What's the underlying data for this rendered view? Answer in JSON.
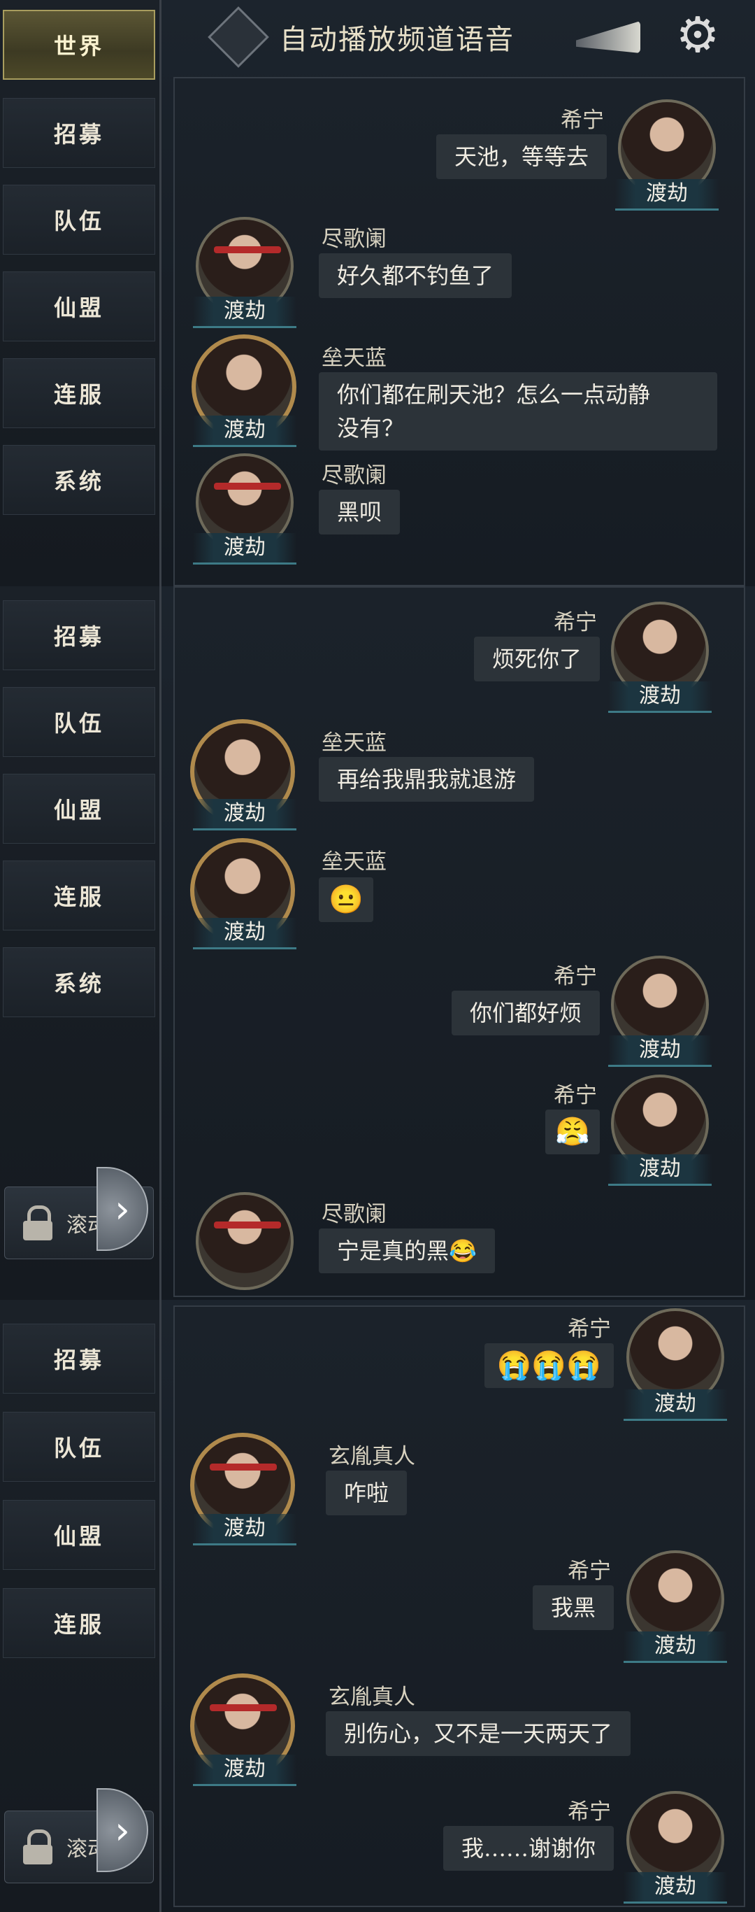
{
  "header": {
    "active_tab": "世界",
    "title": "自动播放频道语音"
  },
  "sidebar_sections": [
    [
      "招募",
      "队伍",
      "仙盟",
      "连服",
      "系统"
    ],
    [
      "招募",
      "队伍",
      "仙盟",
      "连服",
      "系统"
    ],
    [
      "招募",
      "队伍",
      "仙盟",
      "连服"
    ]
  ],
  "lock_label": "滚动",
  "arrow_glyph": "›",
  "rank_tag": "渡劫",
  "messages_1": [
    {
      "name": "希宁",
      "text": "天池，等等去"
    },
    {
      "name": "尽歌阑",
      "text": "好久都不钓鱼了"
    },
    {
      "name": "垒天蓝",
      "text": "你们都在刷天池？怎么一点动静\n没有？"
    },
    {
      "name": "尽歌阑",
      "text": "黑呗"
    }
  ],
  "messages_2": [
    {
      "name": "希宁",
      "text": "烦死你了"
    },
    {
      "name": "垒天蓝",
      "text": "再给我鼎我就退游"
    },
    {
      "name": "垒天蓝",
      "text": "😐"
    },
    {
      "name": "希宁",
      "text": "你们都好烦"
    },
    {
      "name": "希宁",
      "text": "😤"
    },
    {
      "name": "尽歌阑",
      "text": "宁是真的黑😂"
    }
  ],
  "messages_3": [
    {
      "name": "希宁",
      "text": "😭😭😭"
    },
    {
      "name": "玄胤真人",
      "text": "咋啦"
    },
    {
      "name": "希宁",
      "text": "我黑"
    },
    {
      "name": "玄胤真人",
      "text": "别伤心，又不是一天两天了"
    },
    {
      "name": "希宁",
      "text": "我……谢谢你"
    }
  ],
  "icons": {
    "horn": "horn-icon",
    "settings": "gear-icon",
    "lock": "lock-icon",
    "diamond": "diamond-icon"
  }
}
